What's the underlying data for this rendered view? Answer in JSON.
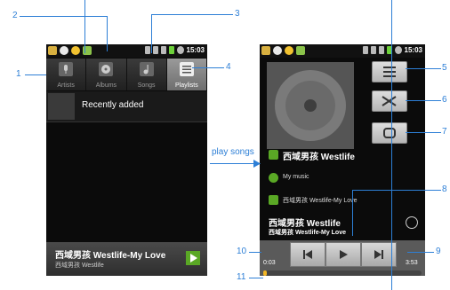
{
  "left_phone": {
    "status_time": "15:03",
    "tabs": [
      {
        "label": "Artists",
        "icon": "mic-icon",
        "selected": false
      },
      {
        "label": "Albums",
        "icon": "album-icon",
        "selected": false
      },
      {
        "label": "Songs",
        "icon": "music-note-icon",
        "selected": false
      },
      {
        "label": "Playlists",
        "icon": "playlist-icon",
        "selected": true
      }
    ],
    "playlist_row": {
      "label": "Recently added"
    },
    "now_playing": {
      "title": "西域男孩 Westlife-My Love",
      "artist": "西域男孩 Westlife"
    }
  },
  "right_phone": {
    "status_time": "15:03",
    "artist_line": "西域男孩 Westlife",
    "album_line": "My music",
    "track_line": "西域男孩 Westlife-My Love",
    "title_big": "西域男孩 Westlife",
    "subtitle": "西域男孩 Westlife-My Love",
    "time_elapsed": "0:03",
    "time_total": "3:53",
    "progress_fraction": 0.013
  },
  "annotations": {
    "arrow_label": "play songs",
    "callouts": [
      "1",
      "2",
      "3",
      "4",
      "5",
      "6",
      "7",
      "8",
      "9",
      "10",
      "11"
    ]
  },
  "colors": {
    "accent_blue": "#2d7fd6",
    "green": "#5aa825"
  }
}
